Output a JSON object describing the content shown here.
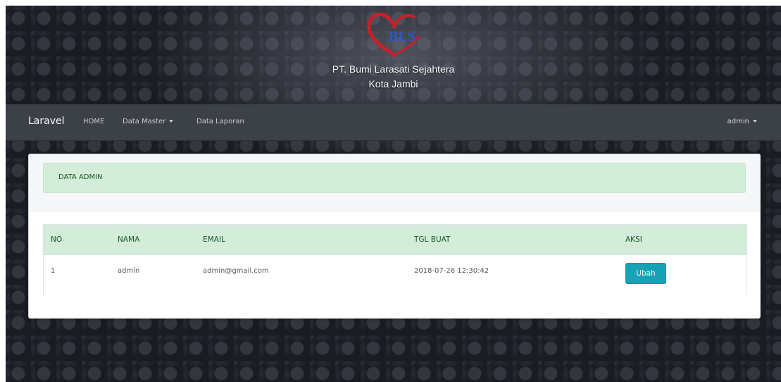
{
  "header": {
    "logo_text": "BLS",
    "company_name": "PT. Bumi Larasati Sejahtera",
    "city": "Kota Jambi"
  },
  "navbar": {
    "brand": "Laravel",
    "items": [
      {
        "label": "HOME"
      },
      {
        "label": "Data Master",
        "dropdown": true
      },
      {
        "label": "Data Laporan"
      }
    ],
    "user": "admin"
  },
  "panel": {
    "title": "DATA ADMIN"
  },
  "table": {
    "columns": [
      "NO",
      "NAMA",
      "EMAIL",
      "TGL BUAT",
      "AKSI"
    ],
    "rows": [
      {
        "no": "1",
        "nama": "admin",
        "email": "admin@gmail.com",
        "tgl_buat": "2018-07-26 12:30:42",
        "action_label": "Ubah"
      }
    ]
  },
  "colors": {
    "navbar": "#3c4147",
    "header_green": "#d4edda",
    "header_text": "#155724",
    "action_button": "#17a2b8"
  }
}
